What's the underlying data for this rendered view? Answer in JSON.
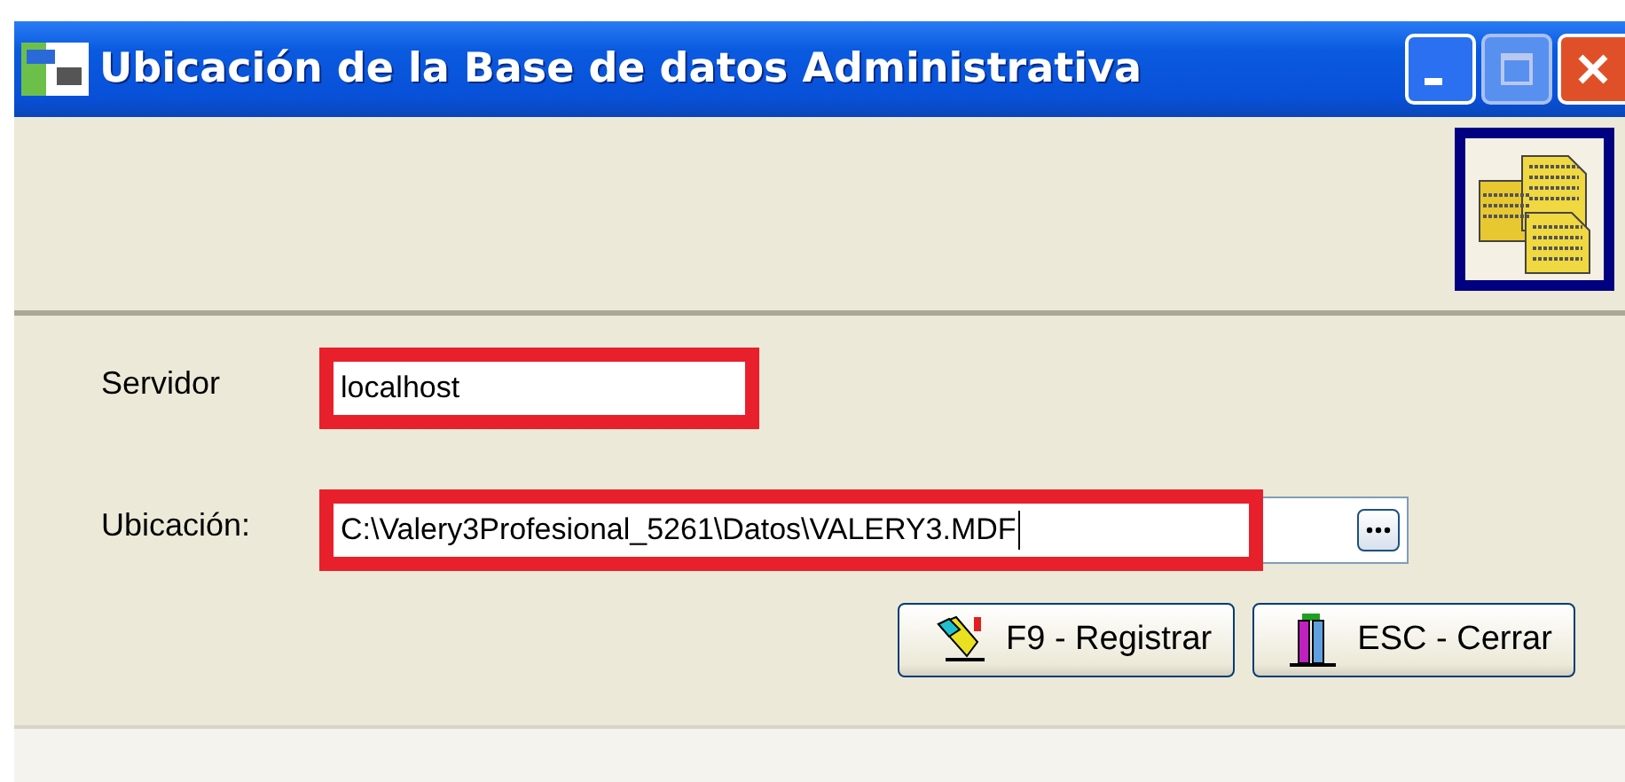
{
  "window": {
    "title": "Ubicación de la Base de datos Administrativa"
  },
  "fields": [
    {
      "label": "Servidor",
      "value": "localhost",
      "highlighted": true,
      "kind": "text"
    },
    {
      "label": "Ubicación:",
      "value": "C:\\Valery3Profesional_5261\\Datos\\VALERY3.MDF",
      "highlighted": true,
      "kind": "browse"
    }
  ],
  "buttons": [
    {
      "label": "F9 - Registrar",
      "kind": "register"
    },
    {
      "label": "ESC - Cerrar",
      "kind": "close"
    }
  ]
}
